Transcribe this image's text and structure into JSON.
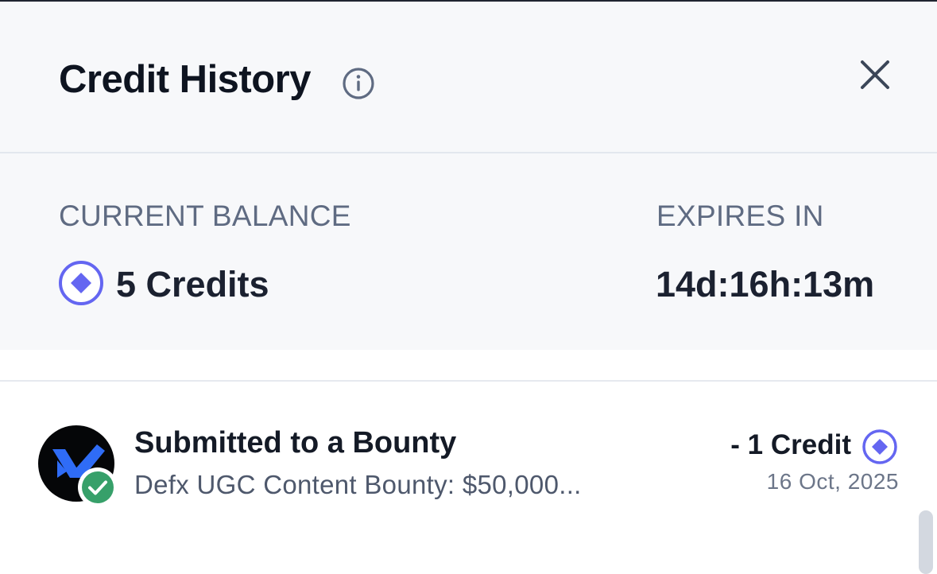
{
  "header": {
    "title": "Credit History"
  },
  "balance": {
    "current_label": "CURRENT BALANCE",
    "current_value": "5 Credits",
    "expires_label": "EXPIRES IN",
    "expires_value": "14d:16h:13m"
  },
  "history": [
    {
      "title": "Submitted to a Bounty",
      "subtitle": "Defx UGC Content Bounty: $50,000...",
      "amount": "- 1 Credit",
      "date": "16 Oct, 2025"
    }
  ],
  "icons": {
    "info": "info-icon",
    "close": "close-icon",
    "credit": "credit-diamond-icon",
    "check": "check-badge-icon"
  },
  "colors": {
    "accent": "#6466f1",
    "check_green": "#37a06a",
    "brand_blue": "#2f6cf6"
  }
}
